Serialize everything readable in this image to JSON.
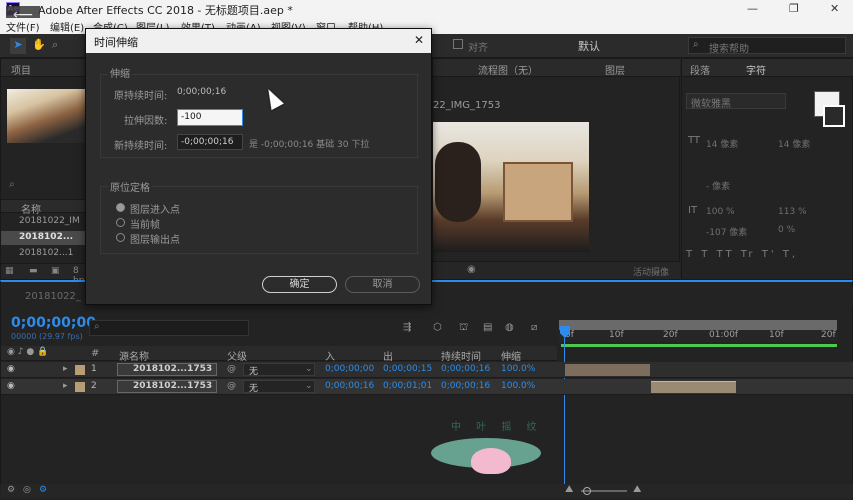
{
  "app": {
    "title": "Adobe After Effects CC 2018 - 无标题项目.aep *",
    "logo": "Ae",
    "window_controls": [
      "—",
      "❐",
      "✕"
    ]
  },
  "menu": [
    "文件(F)",
    "编辑(E)",
    "合成(C)",
    "图层(L)",
    "效果(T)",
    "动画(A)",
    "视图(V)",
    "窗口",
    "帮助(H)"
  ],
  "toolbar": {
    "align_label": "对齐",
    "workspace": "默认",
    "search_placeholder": "搜索帮助"
  },
  "project_panel": {
    "tab": "项目",
    "column_name": "名称",
    "items": [
      "20181022_IM",
      "2018102...",
      "2018102...1"
    ],
    "bpc": "8 bpc"
  },
  "comp_panel": {
    "tab_flow": "流程图（无）",
    "tab_layer": "图层",
    "comp_name": "22_IMG_1753",
    "view_label": "活动摄像"
  },
  "char_panel": {
    "tab_para": "段落",
    "tab_char": "字符",
    "font": "微软雅黑",
    "size1": "14 像素",
    "size2": "14 像素",
    "leading": "- 像素",
    "scale_v": "100 %",
    "scale_h": "113 %",
    "baseline": "-107 像素",
    "tsume": "0 %"
  },
  "dialog": {
    "title": "时间伸缩",
    "close": "✕",
    "stretch_group": "伸缩",
    "orig_duration_label": "原持续时间:",
    "orig_duration_value": "0;00;00;16",
    "factor_label": "拉伸因数:",
    "factor_value": "-100",
    "new_duration_label": "新持续时间:",
    "new_duration_value": "-0;00;00;16",
    "new_duration_note": "是 -0;00;00;16  基础  30  下拉",
    "anchor_group": "原位定格",
    "anchor_options": [
      "图层进入点",
      "当前帧",
      "图层输出点"
    ],
    "anchor_selected_index": 0,
    "ok": "确定",
    "cancel": "取消"
  },
  "timeline": {
    "tab": "20181022_",
    "timecode": "0;00;00;00",
    "fps": "00000 (29.97 fps)",
    "ruler": [
      "0f",
      "10f",
      "20f",
      "01:00f",
      "10f",
      "20f"
    ],
    "headers": {
      "num": "#",
      "source": "源名称",
      "parent": "父级",
      "in": "入",
      "out": "出",
      "duration": "持续时间",
      "stretch": "伸缩"
    },
    "layers": [
      {
        "num": "1",
        "name": "2018102...1753",
        "parent": "无",
        "in": "0;00;00;00",
        "out": "0;00;00;15",
        "duration": "0;00;00;16",
        "stretch": "100.0%"
      },
      {
        "num": "2",
        "name": "2018102...1753",
        "parent": "无",
        "in": "0;00;00;16",
        "out": "0;00;01;01",
        "duration": "0;00;00;16",
        "stretch": "100.0%"
      }
    ],
    "watermark": "中 叶 摇 纹"
  },
  "colors": {
    "accent_blue": "#2d8ceb",
    "work_area_green": "#4ec94e",
    "clip_tan": "#8a7a68"
  }
}
